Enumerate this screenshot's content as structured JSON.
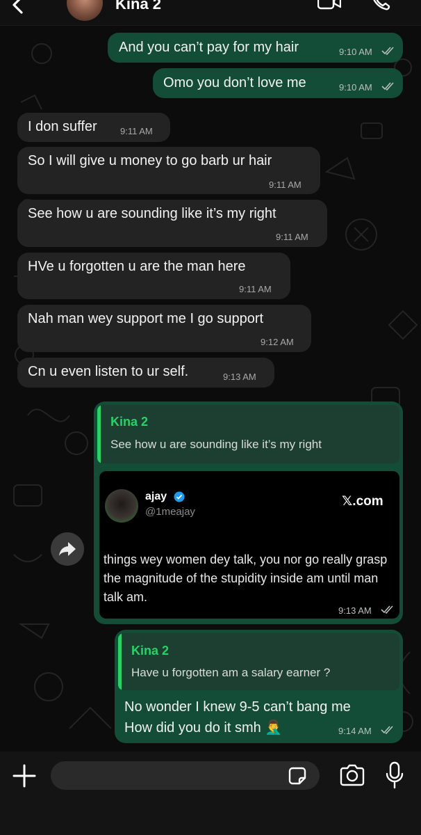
{
  "header": {
    "back_icon": "chevron-left-icon",
    "contact_name": "Kina 2",
    "video_icon": "video-camera-icon",
    "call_icon": "phone-icon"
  },
  "messages": [
    {
      "direction": "outgoing",
      "text": "And you can’t pay for my hair",
      "time": "9:10 AM",
      "status_icon": "double-check-icon"
    },
    {
      "direction": "outgoing",
      "text": "Omo you don’t love me",
      "time": "9:10 AM",
      "status_icon": "double-check-icon"
    },
    {
      "direction": "incoming",
      "text": "I don suffer",
      "time": "9:11 AM"
    },
    {
      "direction": "incoming",
      "text": "So I will give u money to go barb ur hair",
      "time": "9:11 AM"
    },
    {
      "direction": "incoming",
      "text": "See how u are sounding like it’s my right",
      "time": "9:11 AM"
    },
    {
      "direction": "incoming",
      "text": "HVe u forgotten u are the man here",
      "time": "9:11 AM"
    },
    {
      "direction": "incoming",
      "text": "Nah man wey support me I go support",
      "time": "9:12 AM"
    },
    {
      "direction": "incoming",
      "text": "Cn u even listen to ur self.",
      "time": "9:13 AM"
    }
  ],
  "reply_tweet": {
    "quoted_name": "Kina 2",
    "quoted_text": "See how u are sounding like it’s my right",
    "tweet_author": "ajay",
    "tweet_handle": "@1meajay",
    "verified_icon": "verified-badge-icon",
    "source": "𝕏.com",
    "tweet_text": "things wey women dey talk, you nor go really grasp the magnitude of the stupidity inside am until man talk am.",
    "time": "9:13 AM",
    "forward_icon": "forward-icon"
  },
  "reply_last": {
    "quoted_name": "Kina 2",
    "quoted_text": "Have u forgotten am a salary earner ?",
    "line1": "No wonder I knew 9-5 can’t bang me",
    "line2": "How did you do it smh 🤦‍♂️",
    "time": "9:14 AM"
  },
  "composer": {
    "plus_icon": "plus-icon",
    "input_value": "",
    "sticker_icon": "sticker-icon",
    "camera_icon": "camera-icon",
    "mic_icon": "microphone-icon"
  },
  "colors": {
    "outgoing_bubble": "#134d37",
    "incoming_bubble": "#232323",
    "quote_accent": "#25d366",
    "background": "#0b0b0b"
  }
}
